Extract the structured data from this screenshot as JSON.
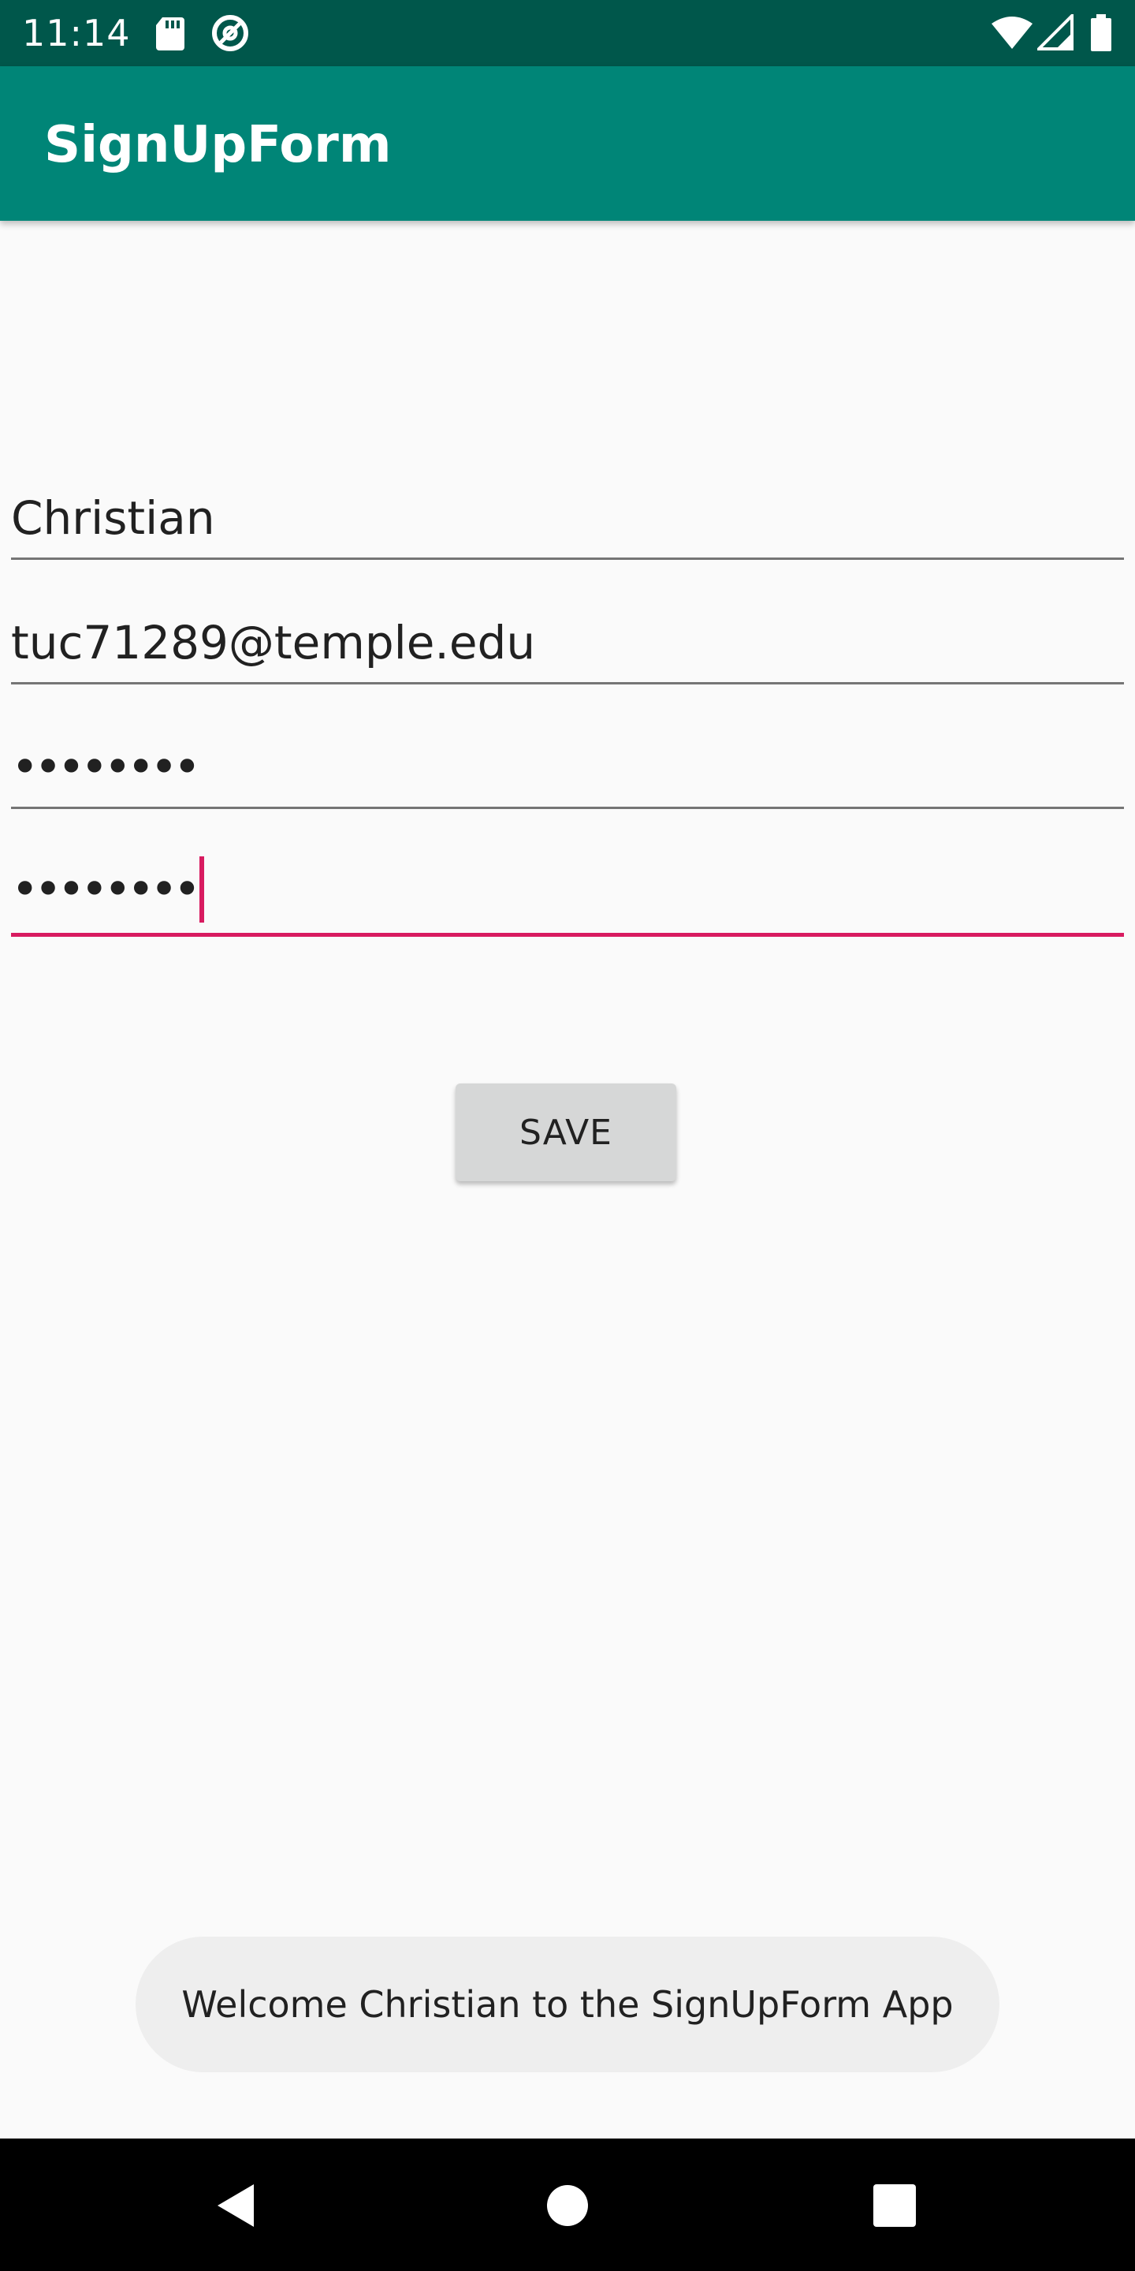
{
  "status_bar": {
    "time": "11:14",
    "icons": [
      "sd-card-icon",
      "at-sign-icon",
      "wifi-icon",
      "signal-icon",
      "battery-icon"
    ]
  },
  "app_bar": {
    "title": "SignUpForm"
  },
  "form": {
    "name_value": "Christian",
    "email_value": "tuc71289@temple.edu",
    "password_value": "••••••••",
    "confirm_password_value": "••••••••"
  },
  "save_button": {
    "label": "SAVE"
  },
  "toast": {
    "message": "Welcome Christian to the SignUpForm App"
  },
  "nav_bar": {
    "icons": [
      "back-icon",
      "home-icon",
      "recents-icon"
    ]
  },
  "colors": {
    "status_bar": "#00574b",
    "app_bar": "#008577",
    "accent": "#d81b60",
    "background": "#fafafa"
  }
}
